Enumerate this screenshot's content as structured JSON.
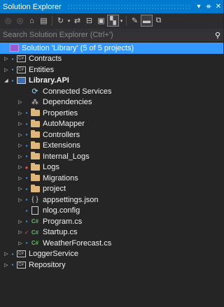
{
  "window": {
    "title": "Solution Explorer",
    "title_buttons": [
      "▾",
      "ᚑ",
      "✕"
    ]
  },
  "toolbar": {
    "icons": [
      "back-icon",
      "forward-icon",
      "home-icon",
      "switch-views-icon",
      "pending-changes-icon",
      "sync-icon",
      "collapse-all-icon",
      "show-all-files-icon",
      "preview-selected-icon",
      "properties-icon",
      "pin-icon",
      "split-icon"
    ]
  },
  "search": {
    "placeholder": "Search Solution Explorer (Ctrl+')"
  },
  "tree": {
    "solution": "Solution 'Library' (5 of 5 projects)",
    "projects": {
      "contracts": "Contracts",
      "entities": "Entities",
      "library_api": "Library.API",
      "logger_service": "LoggerService",
      "repository": "Repository"
    },
    "library_api_children": {
      "connected_services": "Connected Services",
      "dependencies": "Dependencies",
      "properties": "Properties",
      "automapper": "AutoMapper",
      "controllers": "Controllers",
      "extensions": "Extensions",
      "internal_logs": "Internal_Logs",
      "logs": "Logs",
      "migrations": "Migrations",
      "project": "project",
      "appsettings": "appsettings.json",
      "nlog": "nlog.config",
      "program": "Program.cs",
      "startup": "Startup.cs",
      "weatherforecast": "WeatherForecast.cs"
    }
  },
  "colors": {
    "accent": "#007acc",
    "selection": "#3399ff",
    "background": "#252526",
    "folder": "#dcb67a",
    "lock": "#3c9bff"
  }
}
